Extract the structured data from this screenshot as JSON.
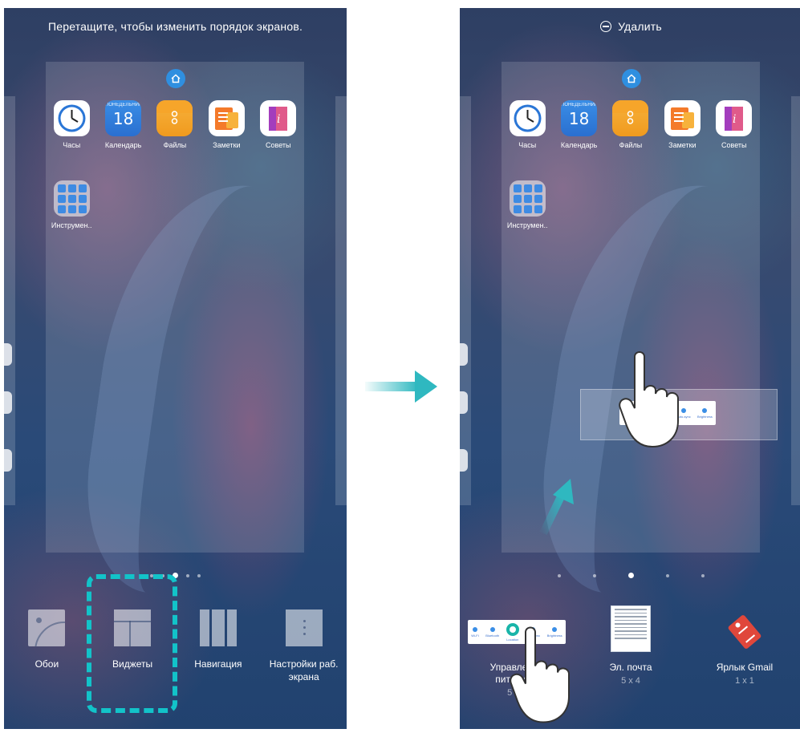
{
  "left_phone": {
    "instruction": "Перетащите, чтобы изменить порядок экранов.",
    "apps": [
      {
        "label": "Часы",
        "icon": "clock-icon"
      },
      {
        "label": "Календарь",
        "icon": "calendar-icon",
        "day": "ПОНЕДЕЛЬНИК",
        "date": "18"
      },
      {
        "label": "Файлы",
        "icon": "files-icon"
      },
      {
        "label": "Заметки",
        "icon": "notes-icon"
      },
      {
        "label": "Советы",
        "icon": "tips-icon"
      }
    ],
    "folder_label": "Инструмен..",
    "page_dots": {
      "count": 5,
      "active": 2
    },
    "bottom_menu": [
      {
        "label": "Обои",
        "icon": "wallpaper-icon"
      },
      {
        "label": "Виджеты",
        "icon": "widgets-icon"
      },
      {
        "label": "Навигация",
        "icon": "navigation-icon"
      },
      {
        "label": "Настройки раб. экрана",
        "icon": "home-settings-icon"
      }
    ],
    "highlight_color": "#12c3c9"
  },
  "right_phone": {
    "delete_label": "Удалить",
    "apps": [
      {
        "label": "Часы",
        "icon": "clock-icon"
      },
      {
        "label": "Календарь",
        "icon": "calendar-icon",
        "day": "ПОНЕДЕЛЬНИК",
        "date": "18"
      },
      {
        "label": "Файлы",
        "icon": "files-icon"
      },
      {
        "label": "Заметки",
        "icon": "notes-icon"
      },
      {
        "label": "Советы",
        "icon": "tips-icon"
      }
    ],
    "folder_label": "Инструмен..",
    "page_dots": {
      "count": 5,
      "active": 2
    },
    "power_widget_labels": [
      "Wi-Fi",
      "Bluetooth",
      "Location",
      "Auto-sync",
      "Brightness"
    ],
    "widgets": [
      {
        "label": "Управление питанием",
        "size": "5 x 1"
      },
      {
        "label": "Эл. почта",
        "size": "5 x 4"
      },
      {
        "label": "Ярлык Gmail",
        "size": "1 x 1"
      }
    ]
  },
  "arrow_color": "#2fb8c0"
}
